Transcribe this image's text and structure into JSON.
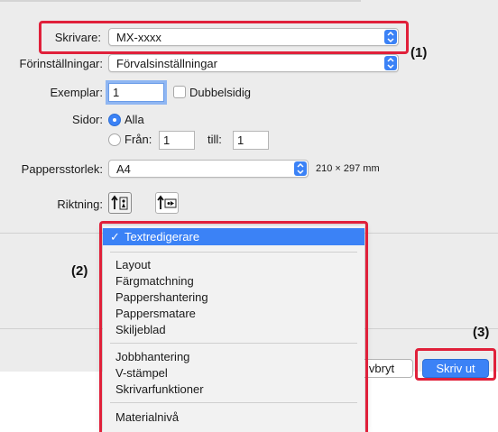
{
  "printer": {
    "label": "Skrivare:",
    "value": "MX-xxxx"
  },
  "presets": {
    "label": "Förinställningar:",
    "value": "Förvalsinställningar"
  },
  "copies": {
    "label": "Exemplar:",
    "value": "1",
    "duplex_label": "Dubbelsidig"
  },
  "pages": {
    "label": "Sidor:",
    "all_label": "Alla",
    "from_label": "Från:",
    "from_value": "1",
    "to_label": "till:",
    "to_value": "1"
  },
  "paper_size": {
    "label": "Pappersstorlek:",
    "value": "A4",
    "dimensions": "210 × 297 mm"
  },
  "orientation": {
    "label": "Riktning:"
  },
  "menu": {
    "selected": "Textredigerare",
    "group1": [
      "Layout",
      "Färgmatchning",
      "Pappershantering",
      "Pappersmatare",
      "Skiljeblad"
    ],
    "group2": [
      "Jobbhantering",
      "V-stämpel",
      "Skrivarfunktioner"
    ],
    "group3": [
      "Materialnivå"
    ]
  },
  "buttons": {
    "cancel_partial": "vbryt",
    "print": "Skriv ut"
  },
  "callouts": {
    "c1": "(1)",
    "c2": "(2)",
    "c3": "(3)"
  },
  "colors": {
    "accent": "#3b82f6",
    "callout": "#e0203a"
  }
}
